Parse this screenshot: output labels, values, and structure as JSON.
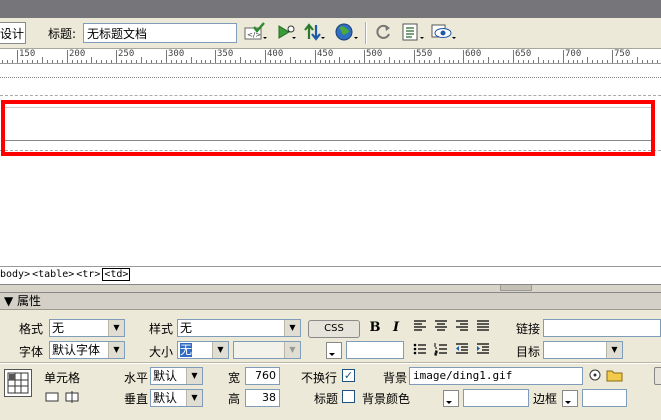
{
  "toolbar": {
    "design_label": "设计",
    "title_label": "标题:",
    "title_value": "无标题文档",
    "icons": [
      "validate-icon",
      "preview-debug-icon",
      "file-transfer-icon",
      "globe-icon",
      "refresh-icon",
      "view-options-icon",
      "visual-aids-icon"
    ]
  },
  "ruler": {
    "labels": [
      "150",
      "200",
      "250",
      "300",
      "350",
      "400",
      "450",
      "500",
      "550",
      "600",
      "650",
      "700",
      "750"
    ]
  },
  "tag_selector": {
    "tags": [
      "body>",
      "<table>",
      "<tr>",
      "<td>"
    ]
  },
  "properties": {
    "header": "▼ 属性",
    "format_label": "格式",
    "format_value": "无",
    "style_label": "样式",
    "style_value": "无",
    "css_button": "CSS",
    "bold_button": "B",
    "italic_button": "I",
    "link_label": "链接",
    "font_label": "字体",
    "font_value": "默认字体",
    "size_label": "大小",
    "size_value": "无",
    "target_label": "目标",
    "cell_label": "单元格",
    "horz_label": "水平",
    "horz_value": "默认",
    "vert_label": "垂直",
    "vert_value": "默认",
    "width_label": "宽",
    "width_value": "760",
    "height_label": "高",
    "height_value": "38",
    "nowrap_label": "不换行",
    "header_label": "标题",
    "bg_label": "背景",
    "bg_value": "image/ding1.gif",
    "bgcolor_label": "背景颜色",
    "border_label": "边框"
  },
  "colors": {
    "selection_outline": "#ff0000",
    "panel_bg": "#ece9d8"
  }
}
